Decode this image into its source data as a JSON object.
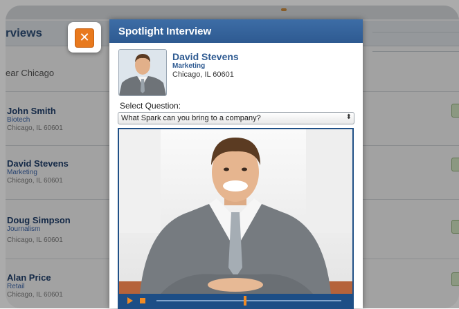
{
  "background": {
    "title": "rviews",
    "search_text": "ear Chicago",
    "rows": [
      {
        "name": "John Smith",
        "dept": "Biotech",
        "location": "Chicago, IL 60601"
      },
      {
        "name": "David Stevens",
        "dept": "Marketing",
        "location": "Chicago, IL 60601"
      },
      {
        "name": "Doug Simpson",
        "dept": "Journalism",
        "location": "Chicago, IL 60601"
      },
      {
        "name": "Alan Price",
        "dept": "Retail",
        "location": "Chicago, IL 60601"
      }
    ]
  },
  "close": {
    "icon": "close-icon",
    "glyph": "✕",
    "color": "#e8791d"
  },
  "modal": {
    "title": "Spotlight Interview",
    "profile": {
      "name": "David Stevens",
      "dept": "Marketing",
      "location": "Chicago, IL 60601"
    },
    "question_label": "Select Question:",
    "question_selected": "What Spark can you bring to a company?",
    "player": {
      "play_icon": "play-icon",
      "stop_icon": "stop-icon",
      "progress": 0.48
    }
  },
  "colors": {
    "accent": "#2e5a91",
    "control_orange": "#f08a24"
  }
}
